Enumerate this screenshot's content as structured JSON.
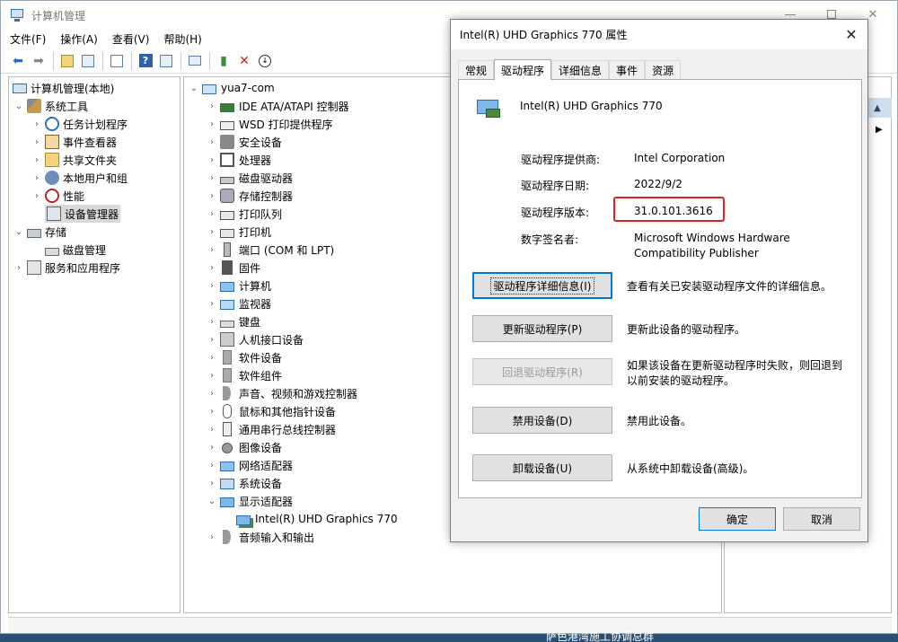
{
  "main_window": {
    "title": "计算机管理",
    "menu": [
      "文件(F)",
      "操作(A)",
      "查看(V)",
      "帮助(H)"
    ]
  },
  "left_tree": [
    {
      "label": "计算机管理(本地)",
      "level": 0,
      "icon": "computer-icon"
    },
    {
      "label": "系统工具",
      "level": 1,
      "icon": "tools-icon",
      "expanded": true
    },
    {
      "label": "任务计划程序",
      "level": 2,
      "icon": "clock-icon"
    },
    {
      "label": "事件查看器",
      "level": 2,
      "icon": "event-icon"
    },
    {
      "label": "共享文件夹",
      "level": 2,
      "icon": "shared-folder-icon"
    },
    {
      "label": "本地用户和组",
      "level": 2,
      "icon": "users-icon"
    },
    {
      "label": "性能",
      "level": 2,
      "icon": "performance-icon"
    },
    {
      "label": "设备管理器",
      "level": 2,
      "icon": "device-manager-icon",
      "selected": true
    },
    {
      "label": "存储",
      "level": 1,
      "icon": "storage-icon",
      "expanded": true
    },
    {
      "label": "磁盘管理",
      "level": 2,
      "icon": "disk-icon"
    },
    {
      "label": "服务和应用程序",
      "level": 1,
      "icon": "services-icon"
    }
  ],
  "device_tree": {
    "root": "yua7-com",
    "categories": [
      "IDE ATA/ATAPI 控制器",
      "WSD 打印提供程序",
      "安全设备",
      "处理器",
      "磁盘驱动器",
      "存储控制器",
      "打印队列",
      "打印机",
      "端口 (COM 和 LPT)",
      "固件",
      "计算机",
      "监视器",
      "键盘",
      "人机接口设备",
      "软件设备",
      "软件组件",
      "声音、视频和游戏控制器",
      "鼠标和其他指针设备",
      "通用串行总线控制器",
      "图像设备",
      "网络适配器",
      "系统设备",
      "显示适配器"
    ],
    "display_child": "Intel(R) UHD Graphics 770",
    "last_category": "音频输入和输出"
  },
  "dialog": {
    "title": "Intel(R) UHD Graphics 770 属性",
    "tabs": [
      "常规",
      "驱动程序",
      "详细信息",
      "事件",
      "资源"
    ],
    "active_tab": "驱动程序",
    "device_name": "Intel(R) UHD Graphics 770",
    "props": {
      "provider_label": "驱动程序提供商:",
      "provider_value": "Intel Corporation",
      "date_label": "驱动程序日期:",
      "date_value": "2022/9/2",
      "version_label": "驱动程序版本:",
      "version_value": "31.0.101.3616",
      "signer_label": "数字签名者:",
      "signer_value_1": "Microsoft Windows Hardware",
      "signer_value_2": "Compatibility Publisher"
    },
    "actions": {
      "details_btn": "驱动程序详细信息(I)",
      "details_desc": "查看有关已安装驱动程序文件的详细信息。",
      "update_btn": "更新驱动程序(P)",
      "update_desc": "更新此设备的驱动程序。",
      "rollback_btn": "回退驱动程序(R)",
      "rollback_desc_1": "如果该设备在更新驱动程序时失败，则回退到",
      "rollback_desc_2": "以前安装的驱动程序。",
      "disable_btn": "禁用设备(D)",
      "disable_desc": "禁用此设备。",
      "uninstall_btn": "卸载设备(U)",
      "uninstall_desc": "从系统中卸载设备(高级)。"
    },
    "ok": "确定",
    "cancel": "取消"
  },
  "taskbar_text": "萨色港湾施工协调总群",
  "colors": {
    "highlight_box": "#e02020",
    "accent": "#0078d7"
  }
}
